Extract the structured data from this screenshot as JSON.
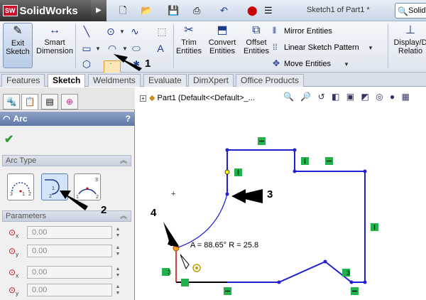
{
  "app": {
    "name": "SolidWorks",
    "logo_badge": "SW",
    "doc_title": "Sketch1 of Part1 *",
    "search_text": "Solid"
  },
  "ribbon": {
    "exit_sketch_label": "Exit\nSketch",
    "smart_dimension_label": "Smart\nDimension",
    "trim_label": "Trim\nEntities",
    "convert_label": "Convert\nEntities",
    "offset_label": "Offset\nEntities",
    "mirror_label": "Mirror Entities",
    "linear_pattern_label": "Linear Sketch Pattern",
    "move_label": "Move Entities",
    "display_label": "Display/D\nRelatio"
  },
  "tabs": [
    {
      "label": "Features",
      "active": false
    },
    {
      "label": "Sketch",
      "active": true
    },
    {
      "label": "Weldments",
      "active": false
    },
    {
      "label": "Evaluate",
      "active": false
    },
    {
      "label": "DimXpert",
      "active": false
    },
    {
      "label": "Office Products",
      "active": false
    }
  ],
  "property_manager": {
    "title": "Arc",
    "help": "?",
    "ok_icon": "check-icon",
    "arc_type_header": "Arc Type",
    "parameters_header": "Parameters",
    "parameters": [
      {
        "icon": "center-x-icon",
        "sub": "x",
        "value": "0.00"
      },
      {
        "icon": "center-y-icon",
        "sub": "y",
        "value": "0.00"
      },
      {
        "icon": "start-x-icon",
        "sub": "x",
        "value": "0.00"
      },
      {
        "icon": "start-y-icon",
        "sub": "y",
        "value": "0.00"
      }
    ]
  },
  "canvas": {
    "tree_node": "Part1  (Default<<Default>_...",
    "tree_expander": "+",
    "sketch_readout": "A = 88.65° R = 25.8"
  },
  "callouts": [
    "1",
    "2",
    "3",
    "4"
  ],
  "colors": {
    "sketch_line": "#2020d0",
    "constrained_line": "#000000",
    "relation_badge": "#22b14c",
    "accent": "#e69a2c"
  }
}
